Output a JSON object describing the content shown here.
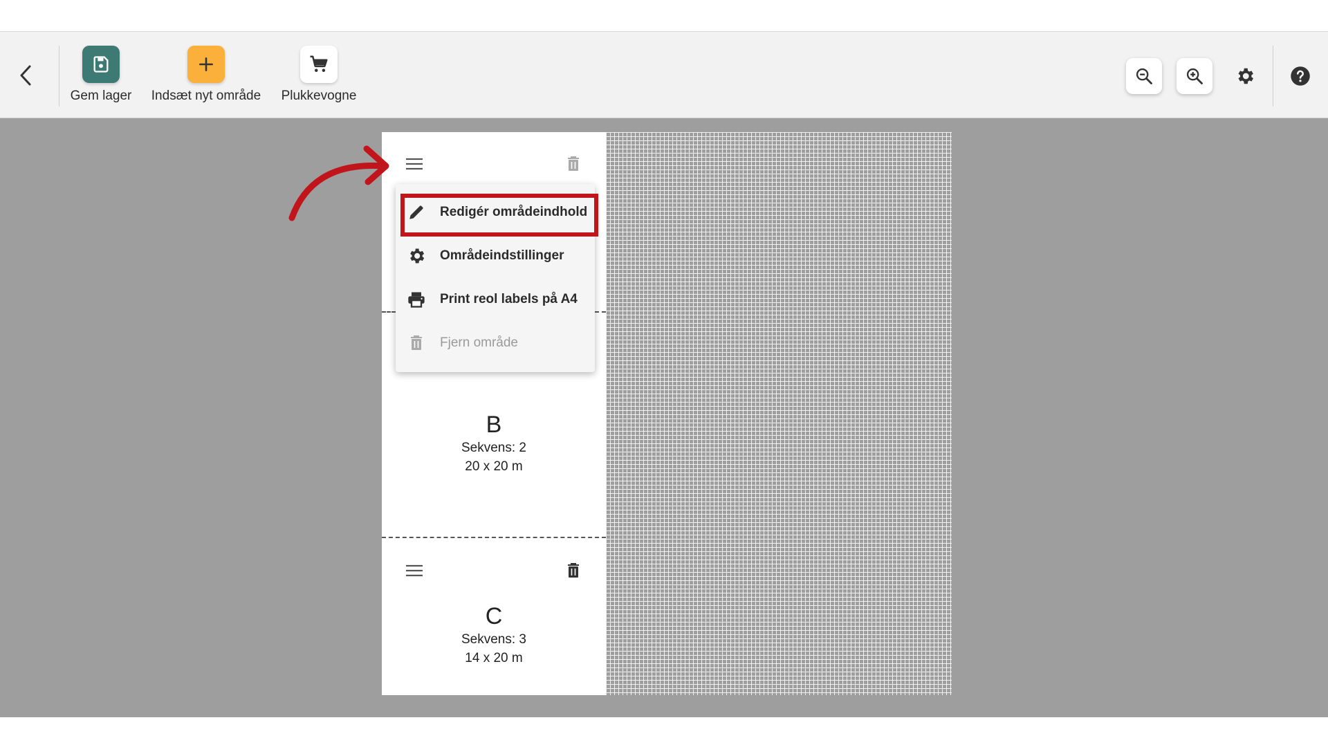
{
  "toolbar": {
    "save_label": "Gem lager",
    "insert_label": "Indsæt nyt område",
    "carts_label": "Plukkevogne",
    "back_icon": "chevron-left-icon",
    "save_icon": "save-icon",
    "insert_icon": "plus-icon",
    "carts_icon": "cart-icon",
    "zoom_out_icon": "zoom-out-icon",
    "zoom_in_icon": "zoom-in-icon",
    "settings_icon": "gear-icon",
    "help_icon": "help-icon",
    "colors": {
      "save_bg": "#3d7a73",
      "insert_bg": "#fbb03b",
      "cart_bg": "#ffffff"
    }
  },
  "menu": {
    "items": [
      {
        "label": "Redigér områdeindhold",
        "icon": "pencil-icon",
        "enabled": true
      },
      {
        "label": "Områdeindstillinger",
        "icon": "gear-icon",
        "enabled": true
      },
      {
        "label": "Print reol labels på A4",
        "icon": "printer-icon",
        "enabled": true
      },
      {
        "label": "Fjern område",
        "icon": "trash-icon",
        "enabled": false
      }
    ],
    "highlight_color": "#c0161b"
  },
  "areas": [
    {
      "name": "B",
      "sequence": "Sekvens: 2",
      "size": "20 x 20 m"
    },
    {
      "name": "C",
      "sequence": "Sekvens: 3",
      "size": "14 x 20 m"
    }
  ],
  "colors": {
    "canvas_bg": "#9e9e9e",
    "toolbar_bg": "#f2f2f2",
    "annotation": "#c0161b"
  }
}
